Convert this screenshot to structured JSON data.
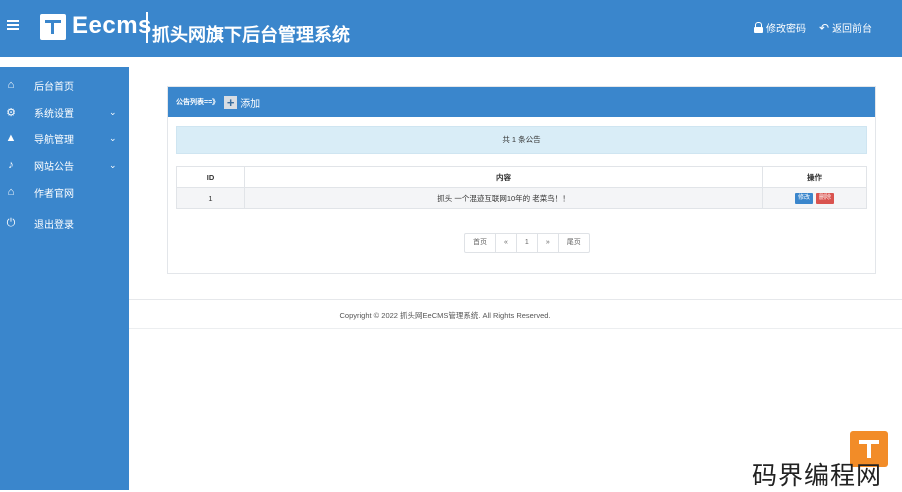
{
  "header": {
    "logo_text": "Eecms",
    "system_title": "抓头网旗下后台管理系统",
    "change_password": "修改密码",
    "back_to_front": "返回前台"
  },
  "sidebar": {
    "items": [
      {
        "label": "后台首页",
        "icon": "home-icon"
      },
      {
        "label": "系统设置",
        "icon": "gear-icon"
      },
      {
        "label": "导航管理",
        "icon": "navigation-arrow-icon"
      },
      {
        "label": "网站公告",
        "icon": "bell-icon"
      },
      {
        "label": "作者官网",
        "icon": "home-icon"
      },
      {
        "label": "退出登录",
        "icon": "power-icon"
      }
    ]
  },
  "panel": {
    "breadcrumb": "公告列表==》",
    "add_label": "添加",
    "count_text": "共 1 条公告",
    "table": {
      "columns": [
        "ID",
        "内容",
        "操作"
      ],
      "rows": [
        {
          "id": "1",
          "content": "抓头 一个混迹互联网10年的 老菜鸟！！",
          "edit": "修改",
          "delete": "删除"
        }
      ]
    },
    "pagination": [
      "首页",
      "«",
      "1",
      "»",
      "尾页"
    ]
  },
  "footer": {
    "copyright": "Copyright © 2022 抓头网EeCMS管理系统. All Rights Reserved."
  },
  "watermark": {
    "text": "码界编程网"
  },
  "colors": {
    "primary": "#3a86cc",
    "danger": "#d9534f",
    "info_bg": "#d9edf7",
    "watermark_orange": "#f28c28"
  }
}
